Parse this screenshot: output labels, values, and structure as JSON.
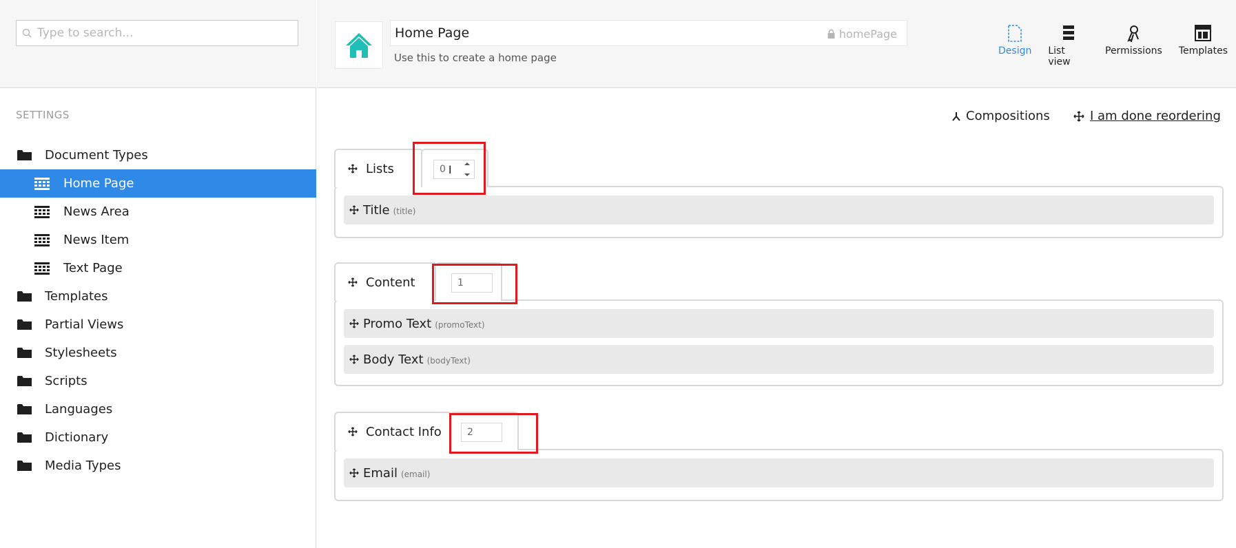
{
  "search": {
    "placeholder": "Type to search..."
  },
  "sidebar": {
    "section_title": "SETTINGS",
    "items": [
      {
        "label": "Document Types",
        "icon": "folder-icon",
        "level": "root"
      },
      {
        "label": "Home Page",
        "icon": "doctype-icon",
        "level": "child",
        "active": true
      },
      {
        "label": "News Area",
        "icon": "doctype-icon",
        "level": "child"
      },
      {
        "label": "News Item",
        "icon": "doctype-icon",
        "level": "child"
      },
      {
        "label": "Text Page",
        "icon": "doctype-icon",
        "level": "child"
      },
      {
        "label": "Templates",
        "icon": "folder-icon",
        "level": "root"
      },
      {
        "label": "Partial Views",
        "icon": "folder-icon",
        "level": "root"
      },
      {
        "label": "Stylesheets",
        "icon": "folder-icon",
        "level": "root"
      },
      {
        "label": "Scripts",
        "icon": "folder-icon",
        "level": "root"
      },
      {
        "label": "Languages",
        "icon": "folder-icon",
        "level": "root"
      },
      {
        "label": "Dictionary",
        "icon": "folder-icon",
        "level": "root"
      },
      {
        "label": "Media Types",
        "icon": "folder-icon",
        "level": "root"
      }
    ]
  },
  "header": {
    "name": "Home Page",
    "alias": "homePage",
    "description": "Use this to create a home page",
    "icon_color": "#1fbfb8"
  },
  "tools": [
    {
      "label": "Design",
      "icon": "design-icon",
      "active": true
    },
    {
      "label": "List view",
      "icon": "list-view-icon"
    },
    {
      "label": "Permissions",
      "icon": "permissions-icon"
    },
    {
      "label": "Templates",
      "icon": "templates-icon"
    }
  ],
  "actions": {
    "compositions": "Compositions",
    "reorder": "I am done reordering"
  },
  "groups": [
    {
      "name": "Lists",
      "sort_order": "0",
      "properties": [
        {
          "name": "Title",
          "alias": "(title)"
        }
      ]
    },
    {
      "name": "Content",
      "sort_order": "1",
      "properties": [
        {
          "name": "Promo Text",
          "alias": "(promoText)"
        },
        {
          "name": "Body Text",
          "alias": "(bodyText)"
        }
      ]
    },
    {
      "name": "Contact Info",
      "sort_order": "2",
      "properties": [
        {
          "name": "Email",
          "alias": "(email)"
        }
      ]
    }
  ],
  "colors": {
    "accent": "#2e8ae6",
    "highlight": "#e3171e"
  }
}
